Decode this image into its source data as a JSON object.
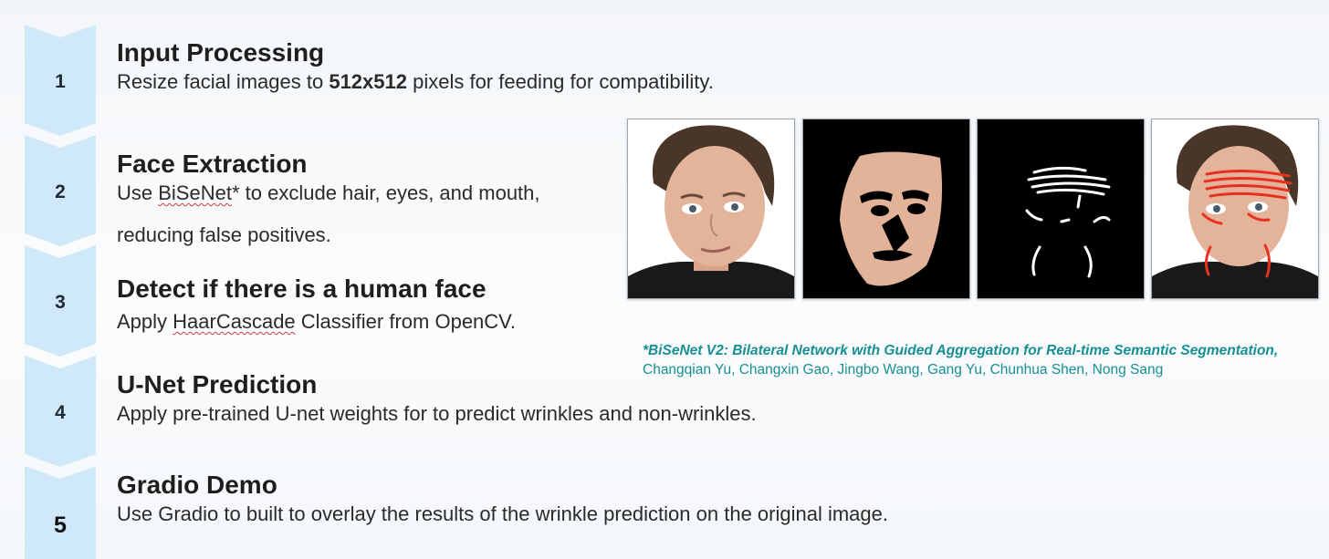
{
  "steps": [
    {
      "number": "1",
      "title": "Input Processing",
      "desc_pre": "Resize facial images to ",
      "desc_bold": "512x512",
      "desc_post": " pixels for feeding for compatibility."
    },
    {
      "number": "2",
      "title": "Face Extraction",
      "desc_pre": "Use ",
      "desc_term": "BiSeNet",
      "desc_post": "* to exclude hair, eyes, and mouth,",
      "desc_line2": "reducing false positives."
    },
    {
      "number": "3",
      "title": "Detect if there is a human face",
      "desc_pre": "Apply ",
      "desc_term": "HaarCascade",
      "desc_post": " Classifier from OpenCV."
    },
    {
      "number": "4",
      "title": "U-Net Prediction",
      "desc": "Apply pre-trained U-net weights for to predict wrinkles and non-wrinkles."
    },
    {
      "number": "5",
      "title": "Gradio Demo",
      "desc": "Use Gradio to built to overlay the results of the wrinkle prediction on the original image."
    }
  ],
  "images": [
    {
      "name": "original-face-photo"
    },
    {
      "name": "face-mask-segmentation"
    },
    {
      "name": "wrinkle-mask"
    },
    {
      "name": "wrinkle-overlay"
    }
  ],
  "citation": {
    "title": "*BiSeNet V2: Bilateral Network with Guided Aggregation for Real-time Semantic Segmentation,",
    "authors": " Changqian Yu, Changxin Gao, Jingbo Wang, Gang Yu, Chunhua Shen, Nong Sang"
  },
  "colors": {
    "chevron_fill": "#cfe9f8",
    "citation": "#168f94",
    "overlay_wrinkle": "#e8301f"
  }
}
